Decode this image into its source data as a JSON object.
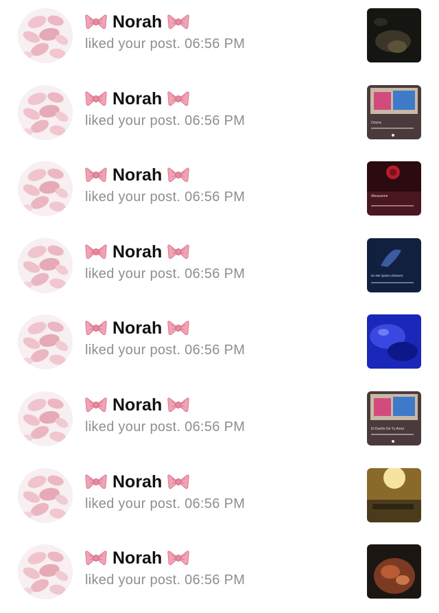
{
  "notifications": [
    {
      "user": "Norah",
      "action": "liked your post.",
      "time": "06:56 PM",
      "thumb_icon": "dark-photo-thumbnail"
    },
    {
      "user": "Norah",
      "action": "liked your post.",
      "time": "06:56 PM",
      "thumb_icon": "music-player-thumbnail",
      "thumb_song": "Ozuna"
    },
    {
      "user": "Norah",
      "action": "liked your post.",
      "time": "06:56 PM",
      "thumb_icon": "rose-album-thumbnail",
      "thumb_song": "Abrazarme"
    },
    {
      "user": "Norah",
      "action": "liked your post.",
      "time": "06:56 PM",
      "thumb_icon": "blue-album-thumbnail",
      "thumb_song": "No Me Quiero (Deluxe)"
    },
    {
      "user": "Norah",
      "action": "liked your post.",
      "time": "06:56 PM",
      "thumb_icon": "blue-light-photo-thumbnail"
    },
    {
      "user": "Norah",
      "action": "liked your post.",
      "time": "06:56 PM",
      "thumb_icon": "music-player-thumbnail",
      "thumb_song": "El Dueño De Tu Amor"
    },
    {
      "user": "Norah",
      "action": "liked your post.",
      "time": "06:56 PM",
      "thumb_icon": "warm-light-photo-thumbnail"
    },
    {
      "user": "Norah",
      "action": "liked your post.",
      "time": "06:56 PM",
      "thumb_icon": "food-photo-thumbnail"
    }
  ],
  "colors": {
    "name": "#111111",
    "secondary": "#8e8e93",
    "bow": "#e88aa0",
    "avatar_bg": "#f6eef0"
  }
}
